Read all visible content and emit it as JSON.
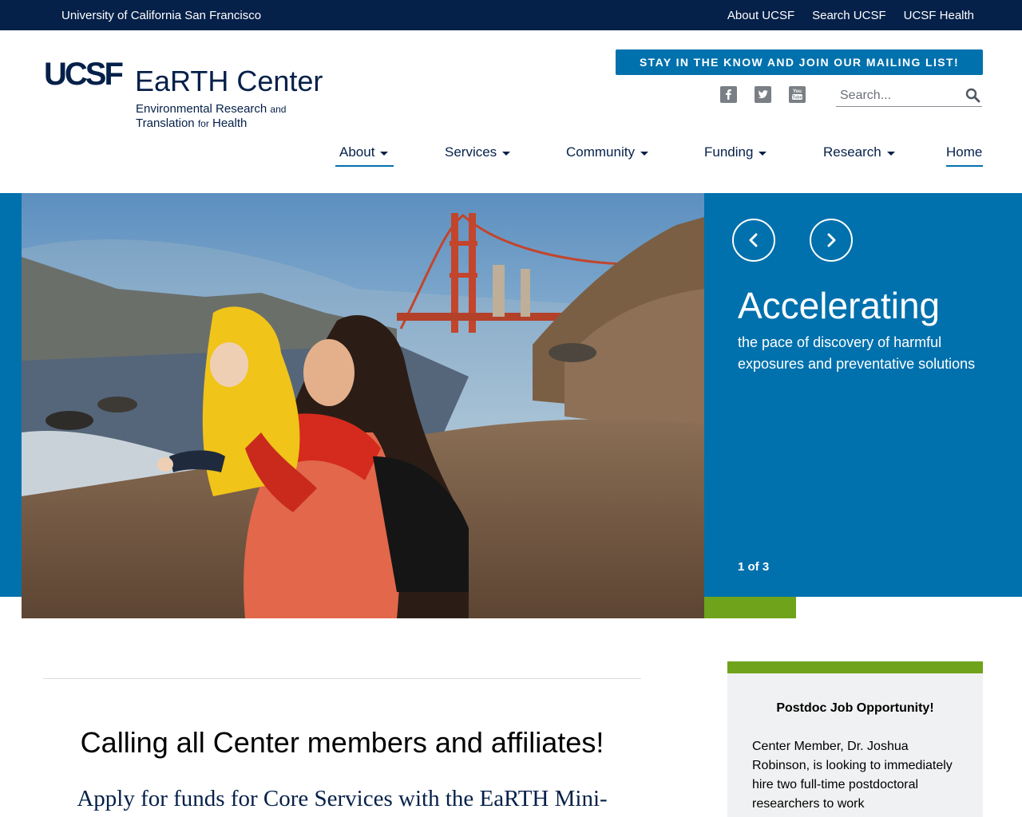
{
  "topbar": {
    "university": "University of California San Francisco",
    "links": [
      "About UCSF",
      "Search UCSF",
      "UCSF Health"
    ]
  },
  "header": {
    "logo_mark": "UCSF",
    "logo_title": "EaRTH Center",
    "logo_sub_line1_a": "Environmental Research ",
    "logo_sub_line1_b": "and",
    "logo_sub_line2_a": "Translation ",
    "logo_sub_line2_b": "for",
    "logo_sub_line2_c": " Health",
    "mailing_label": "STAY IN THE KNOW AND JOIN OUR MAILING LIST!",
    "social": [
      "facebook-icon",
      "twitter-icon",
      "youtube-icon"
    ],
    "search_placeholder": "Search..."
  },
  "nav": {
    "items": [
      {
        "label": "About",
        "dropdown": true
      },
      {
        "label": "Services",
        "dropdown": true
      },
      {
        "label": "Community",
        "dropdown": true
      },
      {
        "label": "Funding",
        "dropdown": true
      },
      {
        "label": "Research",
        "dropdown": true
      },
      {
        "label": "Home",
        "dropdown": false
      }
    ]
  },
  "hero": {
    "title": "Accelerating",
    "text": "the pace of discovery of harmful exposures and preventative solutions",
    "counter": "1 of 3",
    "prev_icon": "chevron-left-icon",
    "next_icon": "chevron-right-icon"
  },
  "main": {
    "headline": "Calling all Center members and affiliates!",
    "subhead": "Apply for funds for Core Services with the EaRTH Mini-"
  },
  "sidebar": {
    "card_title": "Postdoc Job Opportunity!",
    "card_body": "Center Member, Dr. Joshua Robinson, is looking to immediately hire two full-time postdoctoral researchers to work"
  },
  "colors": {
    "navy": "#052049",
    "blue": "#0071ad",
    "green": "#6fa31b"
  }
}
